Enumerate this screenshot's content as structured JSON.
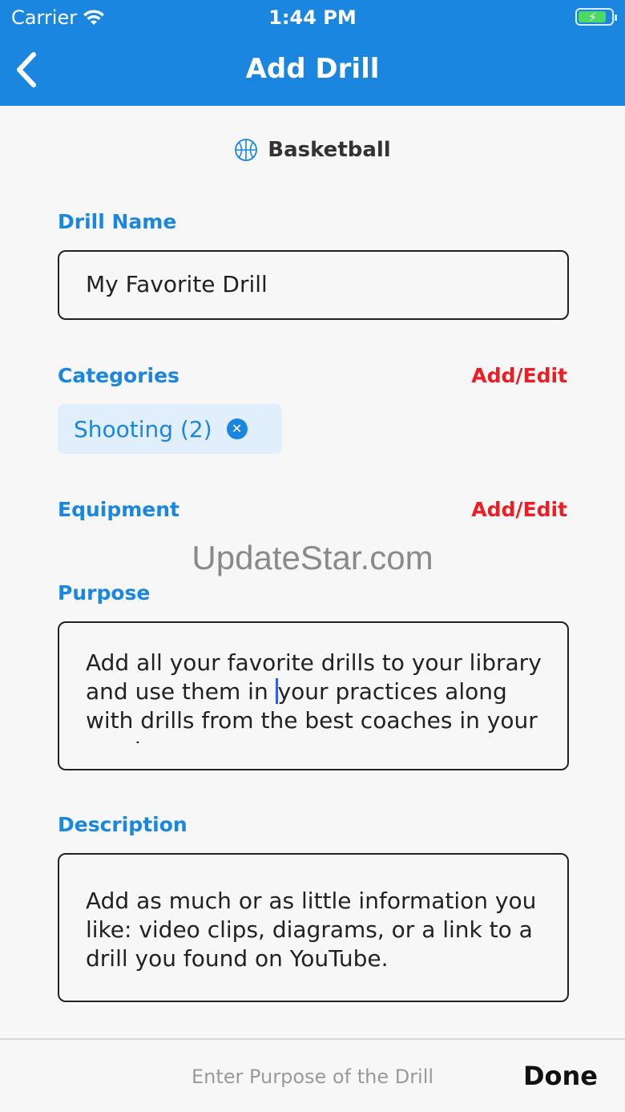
{
  "status_bar": {
    "carrier": "Carrier",
    "time": "1:44 PM",
    "battery_level": 0.85
  },
  "nav": {
    "title": "Add Drill",
    "back_icon": "chevron-left-icon"
  },
  "sport": {
    "name": "Basketball",
    "icon": "basketball-icon"
  },
  "drill_name": {
    "label": "Drill Name",
    "value": "My Favorite Drill"
  },
  "categories": {
    "label": "Categories",
    "action": "Add/Edit",
    "chips": [
      {
        "label": "Shooting (2)"
      }
    ]
  },
  "equipment": {
    "label": "Equipment",
    "action": "Add/Edit"
  },
  "watermark": "UpdateStar.com",
  "purpose": {
    "label": "Purpose",
    "text_before_caret": "Add all your favorite drills to your library and use them in ",
    "text_after_caret": "your practices along with drills from the best coaches in your sport."
  },
  "description": {
    "label": "Description",
    "text": "Add as much or as little information you like: video clips, diagrams, or a link to a drill you found on YouTube."
  },
  "keyboard_toolbar": {
    "hint": "Enter Purpose of the Drill",
    "done_label": "Done"
  },
  "colors": {
    "accent": "#1b86e0",
    "action": "#ef1c23",
    "chip_bg": "#e1eefb"
  }
}
